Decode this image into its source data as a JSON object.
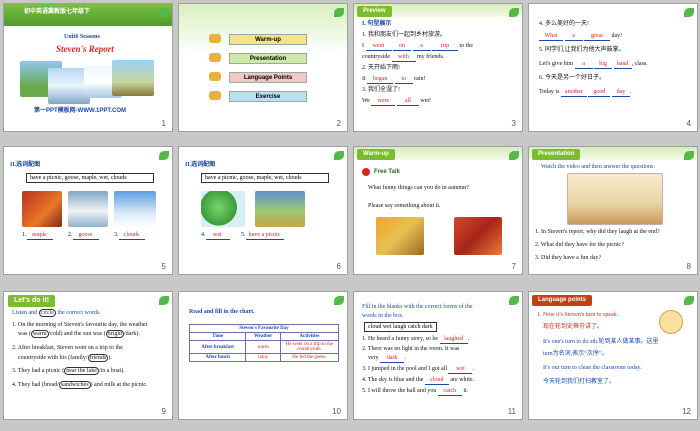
{
  "slides": {
    "s1": {
      "number": "1",
      "course": "初中英语冀教版七年级下",
      "unit": "Unit6  Seasons",
      "title": "Steven's Report",
      "footer": "第一PPT模板网-WWW.1PPT.COM"
    },
    "s2": {
      "number": "2",
      "menu": [
        "Warm-up",
        "Presentation",
        "Language Points",
        "Exercise"
      ]
    },
    "s3": {
      "number": "3",
      "tag": "Preview",
      "heading": "I. 句型展示",
      "l1": "1. 我和朋友们一起到乡村旅游。",
      "l2a": "I",
      "l2b": "went",
      "l2c": "on",
      "l2d": "a",
      "l2e": "trip",
      "l2f": "to the",
      "l3a": "countryside",
      "l3b": "with",
      "l3c": "my friends.",
      "l4": "2. 天开始下雨!",
      "l5a": "It",
      "l5b": "began",
      "l5c": "to",
      "l5d": "rain!",
      "l6": "3. 我们全湿了!",
      "l7a": "We",
      "l7b": "were",
      "l7c": "all",
      "l7d": "wet!"
    },
    "s4": {
      "number": "4",
      "l1": "4. 多么美好的一天!",
      "l2a": "What",
      "l2b": "a",
      "l2c": "great",
      "l2d": "day!",
      "l3": "5. 同学们,让我们为他大声鼓掌。",
      "l4a": "Let's give him",
      "l4b": "a",
      "l4c": "big",
      "l4d": "hand",
      "l4e": ", class.",
      "l5": "6. 今天是另一个好日子。",
      "l6a": "Today is",
      "l6b": "another",
      "l6c": "good",
      "l6d": "day",
      "l6e": "."
    },
    "s5": {
      "number": "5",
      "heading": "II.选词配图",
      "words": "have a picnic, goose, maple, wet, clouds",
      "a1n": "1.",
      "a1": "maple",
      "a2n": "2.",
      "a2": "goose",
      "a3n": "3.",
      "a3": "clouds"
    },
    "s6": {
      "number": "6",
      "heading": "II.选词配图",
      "words": "have a picnic, goose, maple, wet, clouds",
      "a4n": "4.",
      "a4": "wet",
      "a5n": "5.",
      "a5": "have a picnic"
    },
    "s7": {
      "number": "7",
      "tag": "Warm-up",
      "sub": "Free Talk",
      "q1": "What funny things can you do in autumn?",
      "q2": "Please say something about it."
    },
    "s8": {
      "number": "8",
      "tag": "Presentation",
      "intro": "Watch the video and then answer the questions.",
      "q1": "1. In Steven's report, why did they laugh at the end?",
      "q2": "2. What did they have for the picnic?",
      "q3": "3. Did they have a fun day?"
    },
    "s9": {
      "number": "9",
      "tag": "Let's do it!",
      "intro_a": "Listen and",
      "intro_circle": "circle",
      "intro_b": "the correct words.",
      "l1": "1. On the morning of Steven's favourite day, the weather",
      "l1b_a": "was",
      "l1b_c1": "warm",
      "l1b_b": "/cold) and the sun was",
      "l1b_c2": "bright",
      "l1b_d": "/dark).",
      "l2": "2. After breakfast, Steven went on a trip to the",
      "l2b_a": "countryside with his (family/",
      "l2b_c": "friends",
      "l2b_d": ").",
      "l3_a": "3. They had a picnic",
      "l3_c": "near the lake",
      "l3_b": "/in a boat).",
      "l4_a": "4. They had (bread/",
      "l4_c": "sandwiches",
      "l4_b": ") and milk at the picnic."
    },
    "s10": {
      "number": "10",
      "intro": "Read and fill in the chart.",
      "chart_title": "Steven's Favourite Day",
      "headers": [
        "Time",
        "Weather",
        "Activities"
      ],
      "rows": [
        [
          "After breakfast",
          "warm",
          "He went on a trip to the countryside."
        ],
        [
          "After lunch",
          "rainy",
          "He fed the geese."
        ]
      ]
    },
    "s11": {
      "number": "11",
      "intro1": "Fill  in the blanks with the correct forms  of the",
      "intro2": "words in the box.",
      "words": "cloud wet laugh catch dark",
      "l1a": "1. He heard a funny story, so he",
      "l1b": "laughed",
      "l1c": ".",
      "l2": "2. There was no light in the room.  It was",
      "l2b_a": "very",
      "l2b_b": "dark",
      "l2b_c": ".",
      "l3a": "3. I jumped in the pool and I got all",
      "l3b": "wet",
      "l3c": ".",
      "l4a": "4. The sky is blue and the",
      "l4b": "cloud",
      "l4c": "are white.",
      "l5a": "5. I  will  throw  the ball  and you",
      "l5b": "catch",
      "l5c": "it."
    },
    "s12": {
      "number": "12",
      "tag": "Language points",
      "l1": "1. Now it's Steven's turn to speak.",
      "l2": "现在轮到史蒂芬讲了。",
      "l3": "It's one's turn to do sth.轮到某人做某事。这里",
      "l4": "turn为名词,表示“次序”。",
      "l5": "It's our turn to clean the classroom today.",
      "l6": "今天轮到我们打扫教室了。"
    }
  }
}
